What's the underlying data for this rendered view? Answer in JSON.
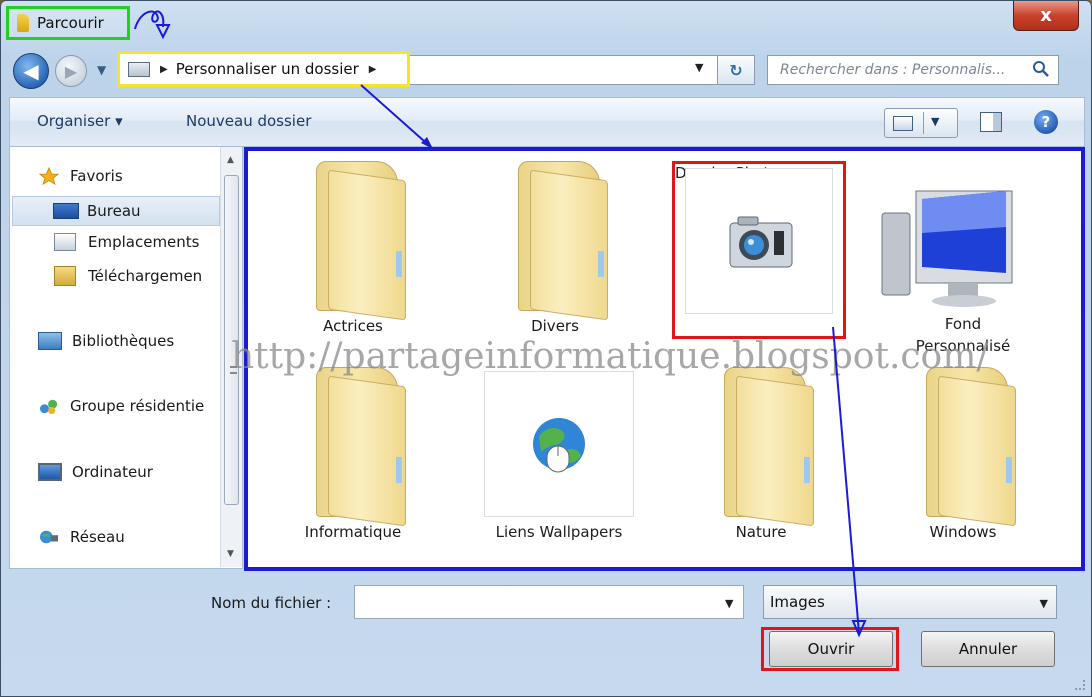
{
  "window": {
    "title": "Parcourir",
    "close_label": "x"
  },
  "address": {
    "path_segment": "Personnaliser un dossier",
    "search_placeholder": "Rechercher dans : Personnalis...",
    "back_glyph": "◀",
    "fwd_glyph": "▶"
  },
  "toolbar": {
    "organiser_label": "Organiser ▾",
    "new_folder_label": "Nouveau dossier",
    "help_glyph": "?"
  },
  "sidebar": {
    "items": [
      {
        "label": "Favoris",
        "icon": "star-icon"
      },
      {
        "label": "Bureau",
        "icon": "desktop-icon",
        "selected": true
      },
      {
        "label": "Emplacements",
        "icon": "places-icon"
      },
      {
        "label": "Téléchargemen",
        "icon": "download-folder-icon"
      },
      {
        "label": "Bibliothèques",
        "icon": "libraries-icon"
      },
      {
        "label": "Groupe résidentie",
        "icon": "homegroup-icon"
      },
      {
        "label": "Ordinateur",
        "icon": "computer-icon"
      },
      {
        "label": "Réseau",
        "icon": "network-icon"
      }
    ]
  },
  "content": {
    "items": [
      {
        "label": "Actrices",
        "icon": "folder-icon"
      },
      {
        "label": "Divers",
        "icon": "folder-icon"
      },
      {
        "label": "Dossier  Photos",
        "icon": "camera-icon"
      },
      {
        "label": "Fond",
        "label2": "Personnalisé",
        "icon": "monitor-icon"
      },
      {
        "label": "Informatique",
        "icon": "folder-icon"
      },
      {
        "label": "Liens Wallpapers",
        "icon": "globe-icon"
      },
      {
        "label": "Nature",
        "icon": "folder-icon"
      },
      {
        "label": "Windows",
        "icon": "folder-icon"
      }
    ],
    "watermark": "http://partageinformatique.blogspot.com/"
  },
  "footer": {
    "filename_label": "Nom du fichier :",
    "filename_value": "",
    "filetype_value": "Images",
    "open_label": "Ouvrir",
    "cancel_label": "Annuler"
  },
  "colors": {
    "title_highlight": "#21d021",
    "address_highlight": "#f5e52a",
    "content_border": "#1b1bd6",
    "selection_highlight": "#e01616",
    "annotation_arrow": "#1b1bd6"
  }
}
